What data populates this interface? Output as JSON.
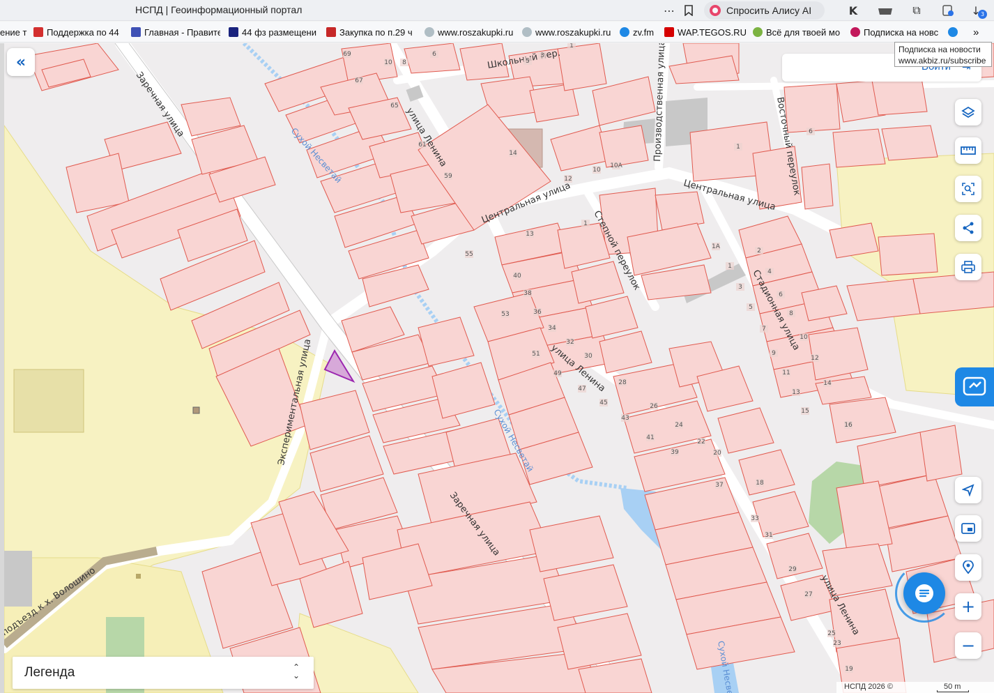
{
  "browser": {
    "page_title": "НСПД | Геоинформационный портал",
    "alice_button": "Спросить Алису AI",
    "notification_count": "3",
    "bookmarks": [
      {
        "label": "ение т",
        "color": "#cccccc"
      },
      {
        "label": "Поддержка по 44",
        "color": "#d32f2f"
      },
      {
        "label": "Главная - Правите",
        "color": "#3f51b5"
      },
      {
        "label": "44 фз размещени",
        "color": "#1a237e"
      },
      {
        "label": "Закупка по п.29 ч",
        "color": "#c62828"
      },
      {
        "label": "www.roszakupki.ru",
        "color": "#90a4ae"
      },
      {
        "label": "www.roszakupki.ru",
        "color": "#90a4ae"
      },
      {
        "label": "zv.fm",
        "color": "#1e88e5"
      },
      {
        "label": "WAP.TEGOS.RU",
        "color": "#d50000"
      },
      {
        "label": "Всё для твоей мо",
        "color": "#7cb342"
      },
      {
        "label": "Подписка на новс",
        "color": "#c2185b"
      },
      {
        "label": "",
        "color": "#1e88e5"
      }
    ],
    "tooltip": {
      "line1": "Подписка на новости",
      "line2": "www.akbiz.ru/subscribe"
    }
  },
  "ui": {
    "login_label": "Войти",
    "legend_label": "Легенда",
    "attribution": "НСПД 2026 ©",
    "scale_label": "50 m"
  },
  "map": {
    "colors": {
      "parcel_fill": "#f9d5d3",
      "parcel_stroke": "#e05a4f",
      "selected_fill": "#d7a9d9",
      "selected_stroke": "#9c27b0",
      "agri_fill": "#f7f2c2",
      "road": "#ffffff",
      "water": "#a8d0f4",
      "building": "#d4b8b0",
      "grey_building": "#c8c8c8",
      "green_area": "#b7d7a8"
    },
    "street_labels": [
      "Заречная улица",
      "Школьный пер.",
      "Производственная улица",
      "Восточный переулок",
      "улица Ленина",
      "Центральная улица",
      "Степной переулок",
      "Стадионная улица",
      "Экспериментальная улица",
      "Сухой Несветай",
      "подъезд к х. Волошино"
    ],
    "house_numbers": [
      "69",
      "67",
      "65",
      "61",
      "59",
      "6",
      "10",
      "8",
      "5",
      "3",
      "1",
      "14",
      "12",
      "10",
      "10А",
      "1",
      "6",
      "13",
      "1",
      "55",
      "40",
      "38",
      "36",
      "34",
      "32",
      "30",
      "53",
      "51",
      "49",
      "47",
      "45",
      "43",
      "41",
      "39",
      "37",
      "33",
      "31",
      "29",
      "27",
      "25",
      "23",
      "19",
      "28",
      "26",
      "24",
      "22",
      "20",
      "18",
      "2",
      "4",
      "6",
      "8",
      "10",
      "12",
      "14",
      "16",
      "1А",
      "1",
      "3",
      "5",
      "7",
      "9",
      "11",
      "13",
      "15",
      "16"
    ]
  }
}
